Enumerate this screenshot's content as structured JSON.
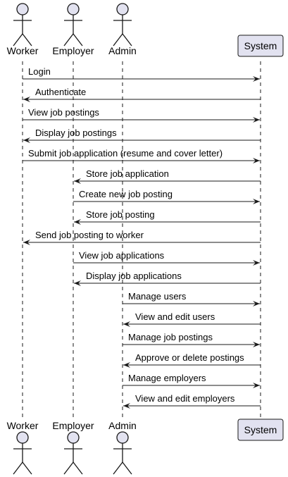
{
  "participants": [
    {
      "id": "worker",
      "label": "Worker",
      "kind": "actor"
    },
    {
      "id": "employer",
      "label": "Employer",
      "kind": "actor"
    },
    {
      "id": "admin",
      "label": "Admin",
      "kind": "actor"
    },
    {
      "id": "system",
      "label": "System",
      "kind": "box"
    }
  ],
  "messages": [
    {
      "from": "worker",
      "to": "system",
      "label": "Login"
    },
    {
      "from": "system",
      "to": "worker",
      "label": "Authenticate"
    },
    {
      "from": "worker",
      "to": "system",
      "label": "View job postings"
    },
    {
      "from": "system",
      "to": "worker",
      "label": "Display job postings"
    },
    {
      "from": "worker",
      "to": "system",
      "label": "Submit job application (resume and cover letter)"
    },
    {
      "from": "system",
      "to": "employer",
      "label": "Store job application"
    },
    {
      "from": "employer",
      "to": "system",
      "label": "Create new job posting"
    },
    {
      "from": "system",
      "to": "employer",
      "label": "Store job posting"
    },
    {
      "from": "system",
      "to": "worker",
      "label": "Send job posting to worker"
    },
    {
      "from": "employer",
      "to": "system",
      "label": "View job applications"
    },
    {
      "from": "system",
      "to": "employer",
      "label": "Display job applications"
    },
    {
      "from": "admin",
      "to": "system",
      "label": "Manage users"
    },
    {
      "from": "system",
      "to": "admin",
      "label": "View and edit users"
    },
    {
      "from": "admin",
      "to": "system",
      "label": "Manage job postings"
    },
    {
      "from": "system",
      "to": "admin",
      "label": "Approve or delete postings"
    },
    {
      "from": "admin",
      "to": "system",
      "label": "Manage employers"
    },
    {
      "from": "system",
      "to": "admin",
      "label": "View and edit employers"
    }
  ],
  "colors": {
    "actor_fill": "#E2E2F0",
    "actor_stroke": "#181818",
    "lifeline": "#181818",
    "arrow": "#181818"
  }
}
